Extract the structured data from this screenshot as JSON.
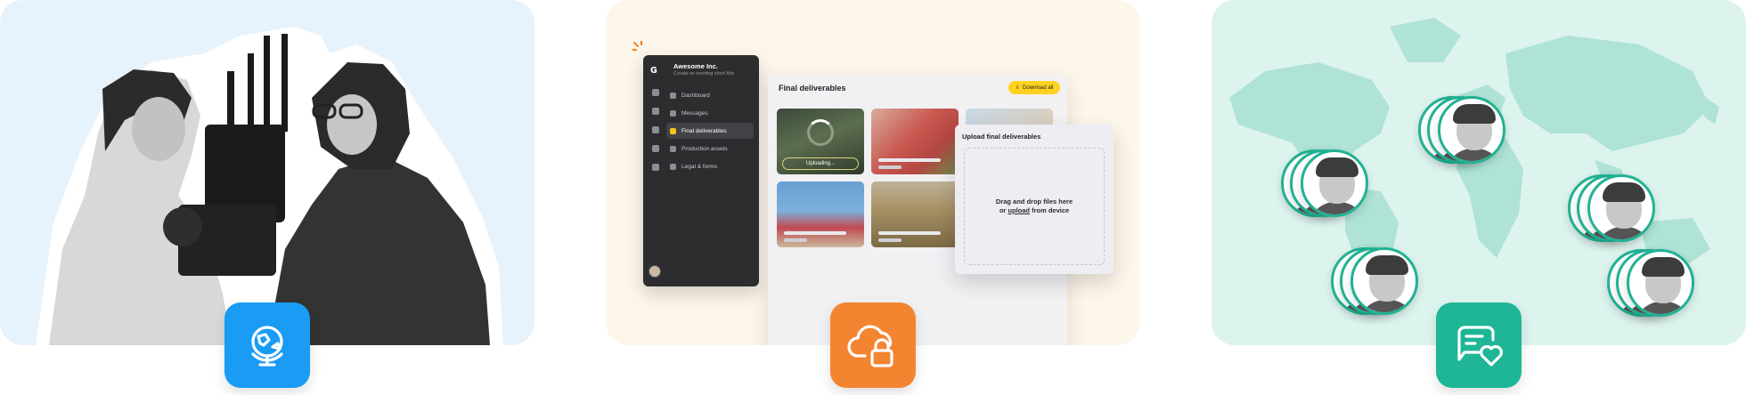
{
  "card1": {
    "badge_icon": "globe-icon",
    "colors": {
      "background": "#e6f2fc",
      "badge": "#1a9bf4"
    }
  },
  "card2": {
    "badge_icon": "cloud-lock-icon",
    "colors": {
      "background": "#fdf6ea",
      "badge": "#f48530",
      "accent": "#ffd21f"
    },
    "sidebar": {
      "company": "Awesome Inc.",
      "tagline": "Create an exciting short film",
      "items": [
        {
          "label": "Dashboard",
          "icon": "dashboard-icon",
          "active": false
        },
        {
          "label": "Messages",
          "icon": "messages-icon",
          "active": false
        },
        {
          "label": "Final deliverables",
          "icon": "deliverables-icon",
          "active": true
        },
        {
          "label": "Production assets",
          "icon": "assets-icon",
          "active": false
        },
        {
          "label": "Legal & forms",
          "icon": "legal-icon",
          "active": false
        }
      ]
    },
    "main": {
      "title": "Final deliverables",
      "download_label": "Download all",
      "uploading_label": "Uploading..."
    },
    "upload_modal": {
      "title": "Upload final deliverables",
      "line1": "Drag and drop files here",
      "line2_prefix": "or ",
      "line2_link": "upload",
      "line2_suffix": " from device"
    }
  },
  "card3": {
    "badge_icon": "chat-heart-icon",
    "colors": {
      "background": "#ddf3ee",
      "badge": "#1eb696",
      "ring": "#20b294"
    }
  }
}
